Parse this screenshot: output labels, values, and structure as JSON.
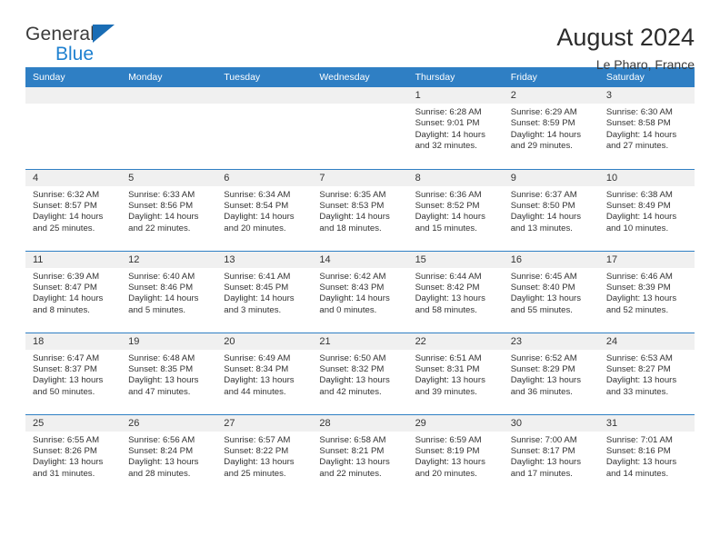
{
  "brand": {
    "name_top": "General",
    "name_bottom": "Blue",
    "accent_color": "#1f81d0",
    "triangle_color": "#1a6db5"
  },
  "header": {
    "title": "August 2024",
    "location": "Le Pharo, France"
  },
  "calendar": {
    "header_color": "#2f7fc4",
    "daynum_band_color": "#f0f0f0",
    "weekday_labels": [
      "Sunday",
      "Monday",
      "Tuesday",
      "Wednesday",
      "Thursday",
      "Friday",
      "Saturday"
    ],
    "weeks": [
      [
        {
          "day": "",
          "empty": true
        },
        {
          "day": "",
          "empty": true
        },
        {
          "day": "",
          "empty": true
        },
        {
          "day": "",
          "empty": true
        },
        {
          "day": "1",
          "sunrise": "Sunrise: 6:28 AM",
          "sunset": "Sunset: 9:01 PM",
          "daylight_line1": "Daylight: 14 hours",
          "daylight_line2": "and 32 minutes."
        },
        {
          "day": "2",
          "sunrise": "Sunrise: 6:29 AM",
          "sunset": "Sunset: 8:59 PM",
          "daylight_line1": "Daylight: 14 hours",
          "daylight_line2": "and 29 minutes."
        },
        {
          "day": "3",
          "sunrise": "Sunrise: 6:30 AM",
          "sunset": "Sunset: 8:58 PM",
          "daylight_line1": "Daylight: 14 hours",
          "daylight_line2": "and 27 minutes."
        }
      ],
      [
        {
          "day": "4",
          "sunrise": "Sunrise: 6:32 AM",
          "sunset": "Sunset: 8:57 PM",
          "daylight_line1": "Daylight: 14 hours",
          "daylight_line2": "and 25 minutes."
        },
        {
          "day": "5",
          "sunrise": "Sunrise: 6:33 AM",
          "sunset": "Sunset: 8:56 PM",
          "daylight_line1": "Daylight: 14 hours",
          "daylight_line2": "and 22 minutes."
        },
        {
          "day": "6",
          "sunrise": "Sunrise: 6:34 AM",
          "sunset": "Sunset: 8:54 PM",
          "daylight_line1": "Daylight: 14 hours",
          "daylight_line2": "and 20 minutes."
        },
        {
          "day": "7",
          "sunrise": "Sunrise: 6:35 AM",
          "sunset": "Sunset: 8:53 PM",
          "daylight_line1": "Daylight: 14 hours",
          "daylight_line2": "and 18 minutes."
        },
        {
          "day": "8",
          "sunrise": "Sunrise: 6:36 AM",
          "sunset": "Sunset: 8:52 PM",
          "daylight_line1": "Daylight: 14 hours",
          "daylight_line2": "and 15 minutes."
        },
        {
          "day": "9",
          "sunrise": "Sunrise: 6:37 AM",
          "sunset": "Sunset: 8:50 PM",
          "daylight_line1": "Daylight: 14 hours",
          "daylight_line2": "and 13 minutes."
        },
        {
          "day": "10",
          "sunrise": "Sunrise: 6:38 AM",
          "sunset": "Sunset: 8:49 PM",
          "daylight_line1": "Daylight: 14 hours",
          "daylight_line2": "and 10 minutes."
        }
      ],
      [
        {
          "day": "11",
          "sunrise": "Sunrise: 6:39 AM",
          "sunset": "Sunset: 8:47 PM",
          "daylight_line1": "Daylight: 14 hours",
          "daylight_line2": "and 8 minutes."
        },
        {
          "day": "12",
          "sunrise": "Sunrise: 6:40 AM",
          "sunset": "Sunset: 8:46 PM",
          "daylight_line1": "Daylight: 14 hours",
          "daylight_line2": "and 5 minutes."
        },
        {
          "day": "13",
          "sunrise": "Sunrise: 6:41 AM",
          "sunset": "Sunset: 8:45 PM",
          "daylight_line1": "Daylight: 14 hours",
          "daylight_line2": "and 3 minutes."
        },
        {
          "day": "14",
          "sunrise": "Sunrise: 6:42 AM",
          "sunset": "Sunset: 8:43 PM",
          "daylight_line1": "Daylight: 14 hours",
          "daylight_line2": "and 0 minutes."
        },
        {
          "day": "15",
          "sunrise": "Sunrise: 6:44 AM",
          "sunset": "Sunset: 8:42 PM",
          "daylight_line1": "Daylight: 13 hours",
          "daylight_line2": "and 58 minutes."
        },
        {
          "day": "16",
          "sunrise": "Sunrise: 6:45 AM",
          "sunset": "Sunset: 8:40 PM",
          "daylight_line1": "Daylight: 13 hours",
          "daylight_line2": "and 55 minutes."
        },
        {
          "day": "17",
          "sunrise": "Sunrise: 6:46 AM",
          "sunset": "Sunset: 8:39 PM",
          "daylight_line1": "Daylight: 13 hours",
          "daylight_line2": "and 52 minutes."
        }
      ],
      [
        {
          "day": "18",
          "sunrise": "Sunrise: 6:47 AM",
          "sunset": "Sunset: 8:37 PM",
          "daylight_line1": "Daylight: 13 hours",
          "daylight_line2": "and 50 minutes."
        },
        {
          "day": "19",
          "sunrise": "Sunrise: 6:48 AM",
          "sunset": "Sunset: 8:35 PM",
          "daylight_line1": "Daylight: 13 hours",
          "daylight_line2": "and 47 minutes."
        },
        {
          "day": "20",
          "sunrise": "Sunrise: 6:49 AM",
          "sunset": "Sunset: 8:34 PM",
          "daylight_line1": "Daylight: 13 hours",
          "daylight_line2": "and 44 minutes."
        },
        {
          "day": "21",
          "sunrise": "Sunrise: 6:50 AM",
          "sunset": "Sunset: 8:32 PM",
          "daylight_line1": "Daylight: 13 hours",
          "daylight_line2": "and 42 minutes."
        },
        {
          "day": "22",
          "sunrise": "Sunrise: 6:51 AM",
          "sunset": "Sunset: 8:31 PM",
          "daylight_line1": "Daylight: 13 hours",
          "daylight_line2": "and 39 minutes."
        },
        {
          "day": "23",
          "sunrise": "Sunrise: 6:52 AM",
          "sunset": "Sunset: 8:29 PM",
          "daylight_line1": "Daylight: 13 hours",
          "daylight_line2": "and 36 minutes."
        },
        {
          "day": "24",
          "sunrise": "Sunrise: 6:53 AM",
          "sunset": "Sunset: 8:27 PM",
          "daylight_line1": "Daylight: 13 hours",
          "daylight_line2": "and 33 minutes."
        }
      ],
      [
        {
          "day": "25",
          "sunrise": "Sunrise: 6:55 AM",
          "sunset": "Sunset: 8:26 PM",
          "daylight_line1": "Daylight: 13 hours",
          "daylight_line2": "and 31 minutes."
        },
        {
          "day": "26",
          "sunrise": "Sunrise: 6:56 AM",
          "sunset": "Sunset: 8:24 PM",
          "daylight_line1": "Daylight: 13 hours",
          "daylight_line2": "and 28 minutes."
        },
        {
          "day": "27",
          "sunrise": "Sunrise: 6:57 AM",
          "sunset": "Sunset: 8:22 PM",
          "daylight_line1": "Daylight: 13 hours",
          "daylight_line2": "and 25 minutes."
        },
        {
          "day": "28",
          "sunrise": "Sunrise: 6:58 AM",
          "sunset": "Sunset: 8:21 PM",
          "daylight_line1": "Daylight: 13 hours",
          "daylight_line2": "and 22 minutes."
        },
        {
          "day": "29",
          "sunrise": "Sunrise: 6:59 AM",
          "sunset": "Sunset: 8:19 PM",
          "daylight_line1": "Daylight: 13 hours",
          "daylight_line2": "and 20 minutes."
        },
        {
          "day": "30",
          "sunrise": "Sunrise: 7:00 AM",
          "sunset": "Sunset: 8:17 PM",
          "daylight_line1": "Daylight: 13 hours",
          "daylight_line2": "and 17 minutes."
        },
        {
          "day": "31",
          "sunrise": "Sunrise: 7:01 AM",
          "sunset": "Sunset: 8:16 PM",
          "daylight_line1": "Daylight: 13 hours",
          "daylight_line2": "and 14 minutes."
        }
      ]
    ]
  }
}
